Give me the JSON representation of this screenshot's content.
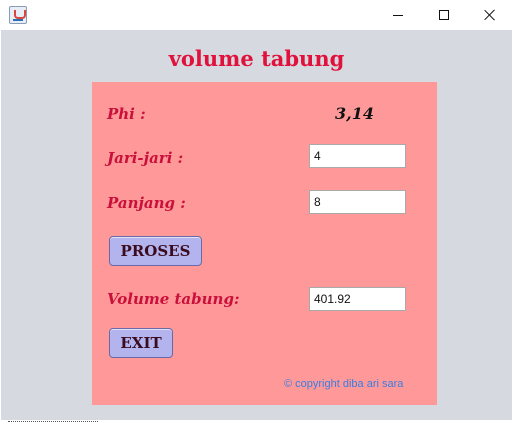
{
  "window": {
    "title": "",
    "controls": {
      "minimize": "minimize",
      "maximize": "maximize",
      "close": "close"
    }
  },
  "form": {
    "title": "volume tabung",
    "phi_label": "Phi :",
    "phi_value": "3,14",
    "radius_label": "Jari-jari :",
    "radius_value": "4",
    "length_label": "Panjang :",
    "length_value": "8",
    "process_button": "PROSES",
    "volume_label": "Volume tabung:",
    "volume_value": "401.92",
    "exit_button": "EXIT",
    "copyright": "© copyright diba ari sara"
  },
  "colors": {
    "panel": "#ff9999",
    "title": "#e0123c",
    "label": "#c8103a",
    "button": "#b3b3ee",
    "copyright": "#3a7de0",
    "window_bg": "#d6d9e0"
  },
  "icons": {
    "app": "java-app-icon"
  }
}
